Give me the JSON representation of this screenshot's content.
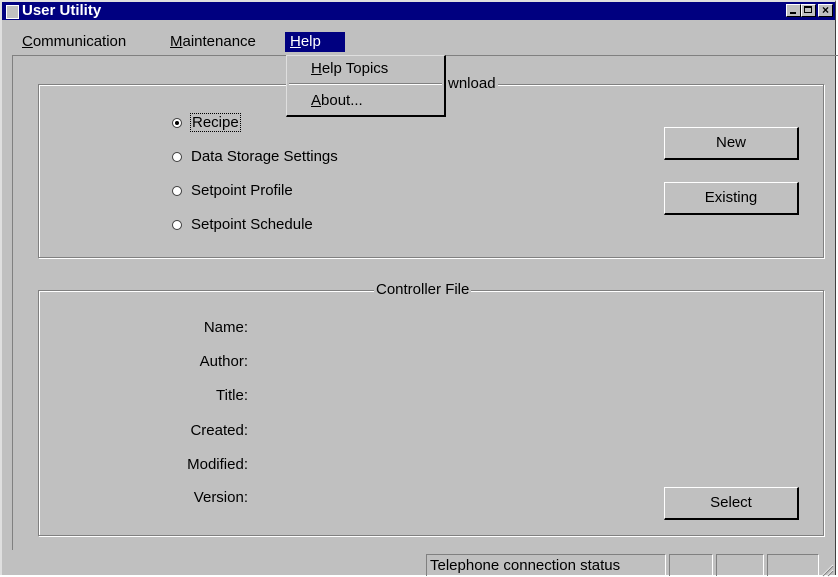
{
  "window": {
    "title": "User Utility",
    "icon": "app-icon",
    "controls": [
      "minimize-icon",
      "maximize-icon",
      "close-icon"
    ],
    "close_glyph": "×"
  },
  "menubar": {
    "communication": "Communication",
    "maintenance": "Maintenance",
    "help": "Help"
  },
  "help_menu": {
    "items": [
      "Help Topics",
      "About..."
    ]
  },
  "download_group": {
    "label_visible": "wnload",
    "options": [
      "Recipe",
      "Data Storage Settings",
      "Setpoint Profile",
      "Setpoint Schedule"
    ],
    "selected": "Recipe",
    "new_button": "New",
    "existing_button": "Existing"
  },
  "controller_file": {
    "label": "Controller File",
    "fields": [
      "Name:",
      "Author:",
      "Title:",
      "Created:",
      "Modified:",
      "Version:"
    ],
    "select_button": "Select"
  },
  "statusbar": {
    "telephone_status": "Telephone connection status"
  },
  "colors": {
    "face": "#c0c0c0",
    "titlebar": "#000080",
    "highlight": "#000080"
  }
}
